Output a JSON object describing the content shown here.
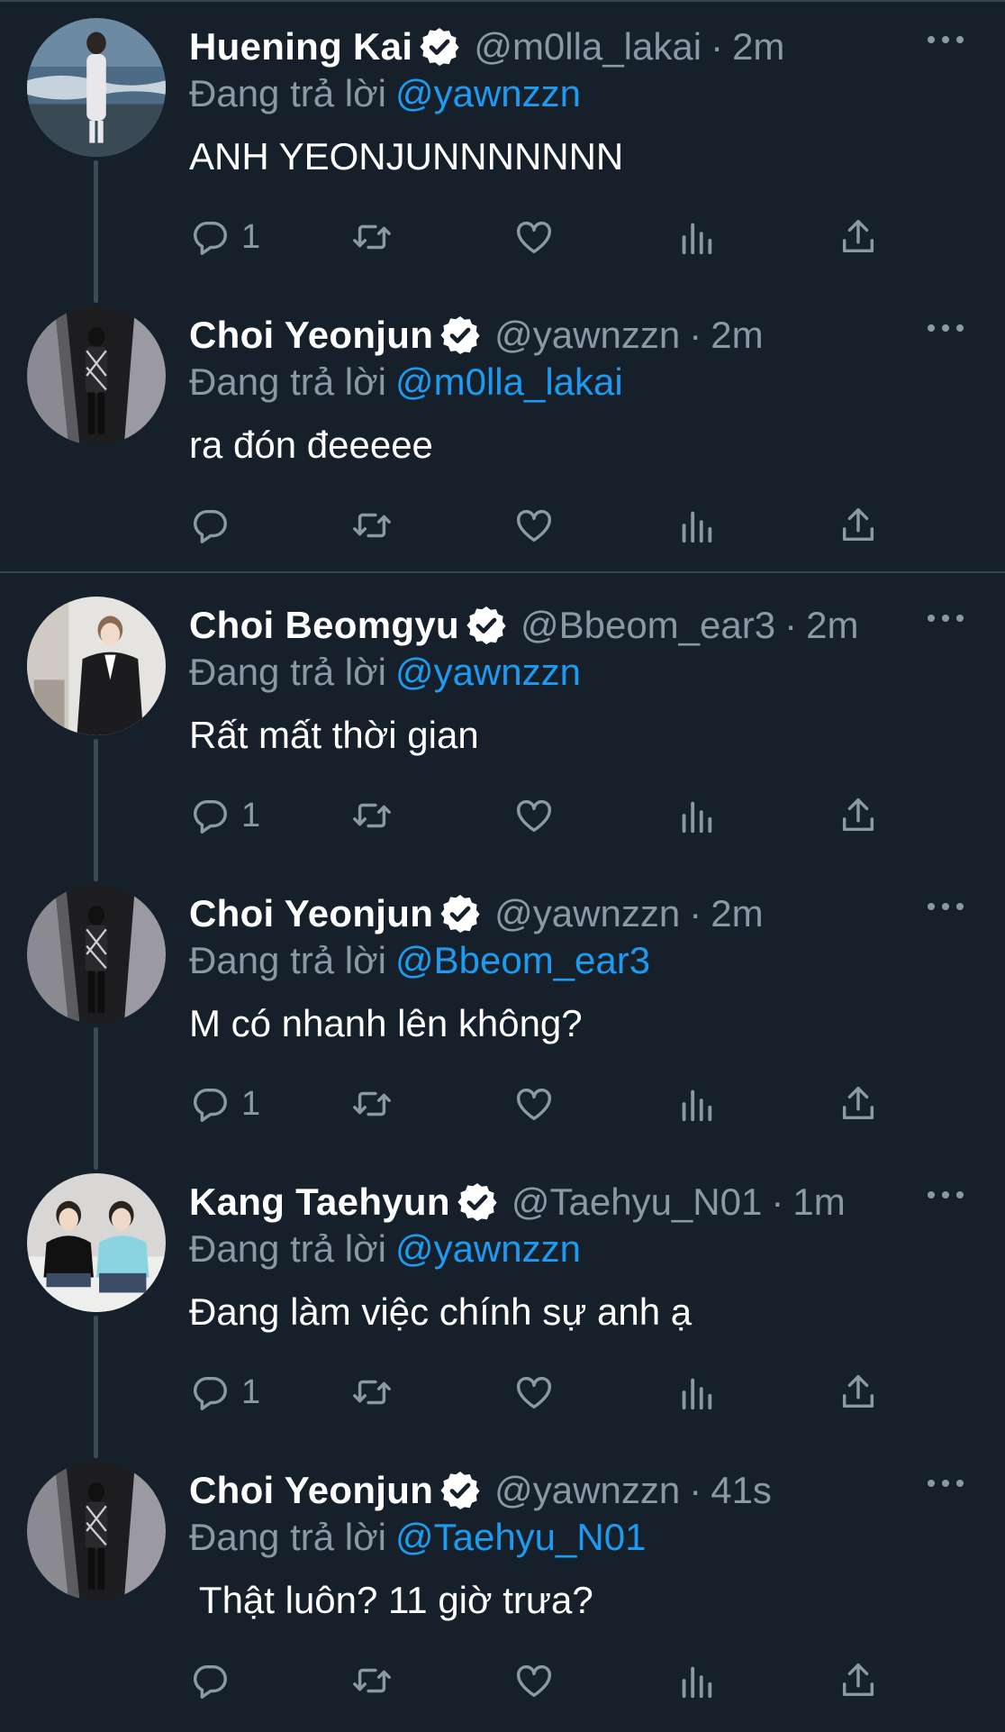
{
  "reply_prefix": "Đang trả lời",
  "separator": "·",
  "colors": {
    "background": "#15202b",
    "muted": "#8b98a5",
    "link": "#1d9bf0",
    "divider": "#38444d"
  },
  "tweets": [
    {
      "name": "Huening Kai",
      "handle": "@m0lla_lakai",
      "time": "2m",
      "reply_to": "@yawnzzn",
      "text": "ANH YEONJUNNNNNNN",
      "replies": "1",
      "avatar_icon": "profile-photo-sea"
    },
    {
      "name": "Choi Yeonjun",
      "handle": "@yawnzzn",
      "time": "2m",
      "reply_to": "@m0lla_lakai",
      "text": "ra đón đeeeee",
      "replies": "",
      "avatar_icon": "profile-photo-dark"
    },
    {
      "name": "Choi Beomgyu",
      "handle": "@Bbeom_ear3",
      "time": "2m",
      "reply_to": "@yawnzzn",
      "text": "Rất mất thời gian",
      "replies": "1",
      "avatar_icon": "profile-photo-light"
    },
    {
      "name": "Choi Yeonjun",
      "handle": "@yawnzzn",
      "time": "2m",
      "reply_to": "@Bbeom_ear3",
      "text": "M có nhanh lên không?",
      "replies": "1",
      "avatar_icon": "profile-photo-dark"
    },
    {
      "name": "Kang Taehyun",
      "handle": "@Taehyu_N01",
      "time": "1m",
      "reply_to": "@yawnzzn",
      "text": "Đang làm việc chính sự anh ạ",
      "replies": "1",
      "avatar_icon": "profile-photo-duo"
    },
    {
      "name": "Choi Yeonjun",
      "handle": "@yawnzzn",
      "time": "41s",
      "reply_to": "@Taehyu_N01",
      "text": " Thật luôn? 11 giờ trưa?",
      "replies": "",
      "avatar_icon": "profile-photo-dark"
    }
  ]
}
